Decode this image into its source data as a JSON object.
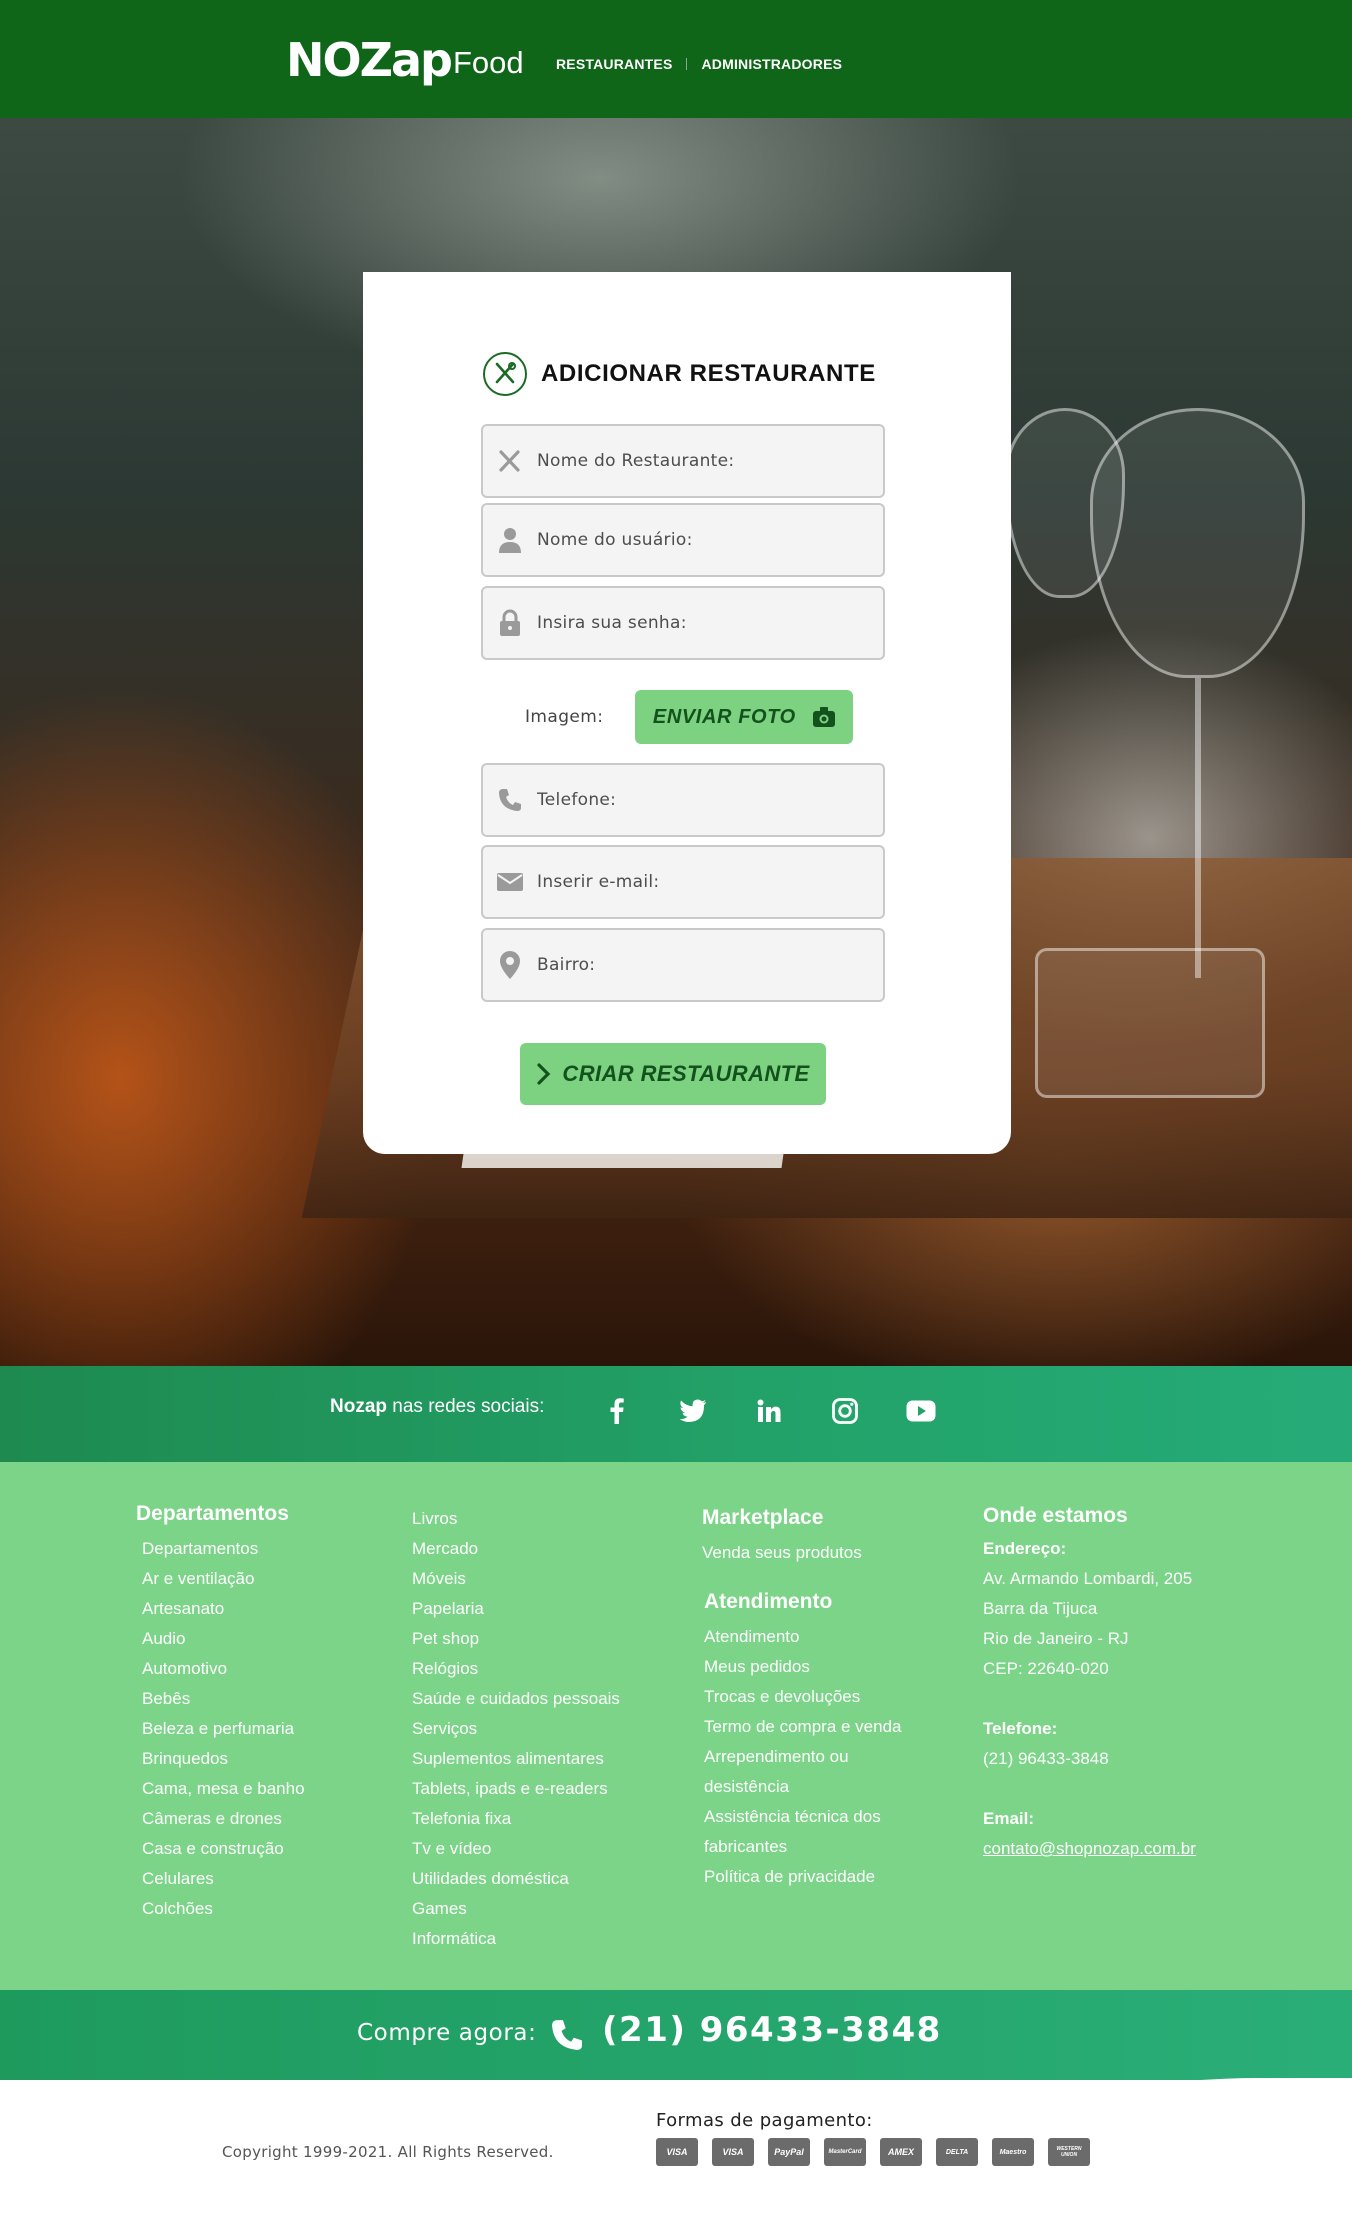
{
  "header": {
    "logo_main": "NOZap",
    "logo_sub": "Food",
    "nav": [
      "RESTAURANTES",
      "ADMINISTRADORES"
    ]
  },
  "form": {
    "title": "ADICIONAR RESTAURANTE",
    "fields": {
      "restaurant_name": "Nome do Restaurante:",
      "username": "Nome do usuário:",
      "password": "Insira sua senha:",
      "phone": "Telefone:",
      "email": "Inserir e-mail:",
      "neighborhood": "Bairro:"
    },
    "image_label": "Imagem:",
    "upload_button": "ENVIAR FOTO",
    "submit_button": "CRIAR RESTAURANTE"
  },
  "social": {
    "brand": "Nozap",
    "text": "nas redes sociais:",
    "icons": [
      "facebook-icon",
      "twitter-icon",
      "linkedin-icon",
      "instagram-icon",
      "youtube-icon"
    ]
  },
  "footer": {
    "departamentos_title": "Departamentos",
    "departamentos_col1": [
      "Departamentos",
      "Ar e ventilação",
      "Artesanato",
      "Audio",
      "Automotivo",
      "Bebês",
      "Beleza e perfumaria",
      "Brinquedos",
      "Cama, mesa e banho",
      "Câmeras e drones",
      "Casa e construção",
      "Celulares",
      "Colchões"
    ],
    "departamentos_col2": [
      "Livros",
      "Mercado",
      "Móveis",
      "Papelaria",
      "Pet shop",
      "Relógios",
      "Saúde e cuidados pessoais",
      "Serviços",
      "Suplementos alimentares",
      "Tablets, ipads e e-readers",
      "Telefonia fixa",
      "Tv e vídeo",
      "Utilidades doméstica",
      "Games",
      "Informática"
    ],
    "marketplace_title": "Marketplace",
    "marketplace_items": [
      "Venda seus produtos"
    ],
    "atendimento_title": "Atendimento",
    "atendimento_items": [
      "Atendimento",
      "Meus pedidos",
      "Trocas e devoluções",
      "Termo de compra e venda",
      "Arrependimento ou",
      "desistência",
      "Assistência técnica dos",
      "fabricantes",
      "Política de privacidade"
    ],
    "onde_title": "Onde estamos",
    "address_label": "Endereço:",
    "address_lines": [
      "Av. Armando Lombardi, 205",
      "Barra da Tijuca",
      "Rio de Janeiro - RJ",
      "CEP: 22640-020"
    ],
    "phone_label": "Telefone:",
    "phone_value": "(21) 96433-3848",
    "email_label": "Email:",
    "email_value": "contato@shopnozap.com.br"
  },
  "call_bar": {
    "text": "Compre agora:",
    "number": "(21) 96433-3848"
  },
  "bottom": {
    "copyright": "Copyright 1999-2021. All Rights Reserved.",
    "payment_title": "Formas de pagamento:",
    "payment_methods": [
      "VISA",
      "VISA",
      "PayPal",
      "MasterCard",
      "AMEX",
      "DELTA",
      "Maestro",
      "WESTERN UNION"
    ]
  },
  "colors": {
    "header_bg": "#0f6618",
    "button_bg": "#7dd282",
    "footer_bg": "#7bd488",
    "bar_bg": "#22a36a"
  }
}
